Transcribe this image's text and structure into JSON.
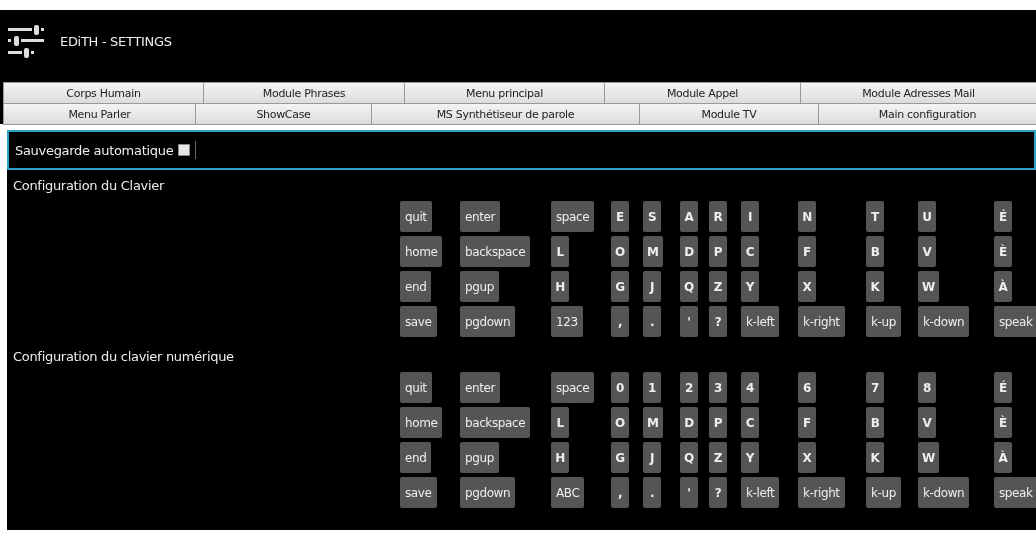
{
  "window": {
    "title": "EDiTH - SETTINGS"
  },
  "tab_rows": [
    {
      "tabs": [
        {
          "label": "Corps Humain",
          "selected": false
        },
        {
          "label": "Module Phrases",
          "selected": false
        },
        {
          "label": "Menu principal",
          "selected": false
        },
        {
          "label": "Module Appel",
          "selected": false
        },
        {
          "label": "Module Adresses Mail",
          "selected": false
        }
      ]
    },
    {
      "tabs": [
        {
          "label": "Menu Parler",
          "selected": false
        },
        {
          "label": "ShowCase",
          "selected": false
        },
        {
          "label": "MS Synthétiseur de parole",
          "selected": false
        },
        {
          "label": "Module TV",
          "selected": false
        },
        {
          "label": "Main configuration",
          "selected": false
        }
      ]
    }
  ],
  "autosave": {
    "label": "Sauvegarde automatique",
    "checked": false
  },
  "sections": [
    {
      "title": "Configuration du Clavier",
      "rows": [
        [
          {
            "label": "quit",
            "kind": "word"
          },
          {
            "label": "enter",
            "kind": "word"
          },
          {
            "label": "space",
            "kind": "word"
          },
          {
            "label": "E",
            "kind": "char"
          },
          {
            "label": "S",
            "kind": "char"
          },
          {
            "label": "A",
            "kind": "char"
          },
          {
            "label": "R",
            "kind": "char"
          },
          {
            "label": "I",
            "kind": "char"
          },
          {
            "label": "N",
            "kind": "char"
          },
          {
            "label": "T",
            "kind": "char"
          },
          {
            "label": "U",
            "kind": "char"
          },
          {
            "label": "É",
            "kind": "char"
          }
        ],
        [
          {
            "label": "home",
            "kind": "word"
          },
          {
            "label": "backspace",
            "kind": "word"
          },
          {
            "label": "L",
            "kind": "char"
          },
          {
            "label": "O",
            "kind": "char"
          },
          {
            "label": "M",
            "kind": "char"
          },
          {
            "label": "D",
            "kind": "char"
          },
          {
            "label": "P",
            "kind": "char"
          },
          {
            "label": "C",
            "kind": "char"
          },
          {
            "label": "F",
            "kind": "char"
          },
          {
            "label": "B",
            "kind": "char"
          },
          {
            "label": "V",
            "kind": "char"
          },
          {
            "label": "È",
            "kind": "char"
          }
        ],
        [
          {
            "label": "end",
            "kind": "word"
          },
          {
            "label": "pgup",
            "kind": "word"
          },
          {
            "label": "H",
            "kind": "char"
          },
          {
            "label": "G",
            "kind": "char"
          },
          {
            "label": "J",
            "kind": "char"
          },
          {
            "label": "Q",
            "kind": "char"
          },
          {
            "label": "Z",
            "kind": "char"
          },
          {
            "label": "Y",
            "kind": "char"
          },
          {
            "label": "X",
            "kind": "char"
          },
          {
            "label": "K",
            "kind": "char"
          },
          {
            "label": "W",
            "kind": "char"
          },
          {
            "label": "À",
            "kind": "char"
          }
        ],
        [
          {
            "label": "save",
            "kind": "word"
          },
          {
            "label": "pgdown",
            "kind": "word"
          },
          {
            "label": "123",
            "kind": "word"
          },
          {
            "label": ",",
            "kind": "char"
          },
          {
            "label": ".",
            "kind": "char"
          },
          {
            "label": "'",
            "kind": "char"
          },
          {
            "label": "?",
            "kind": "char"
          },
          {
            "label": "k-left",
            "kind": "word"
          },
          {
            "label": "k-right",
            "kind": "word"
          },
          {
            "label": "k-up",
            "kind": "word"
          },
          {
            "label": "k-down",
            "kind": "word"
          },
          {
            "label": "speak",
            "kind": "word"
          }
        ]
      ]
    },
    {
      "title": "Configuration du clavier numérique",
      "rows": [
        [
          {
            "label": "quit",
            "kind": "word"
          },
          {
            "label": "enter",
            "kind": "word"
          },
          {
            "label": "space",
            "kind": "word"
          },
          {
            "label": "0",
            "kind": "char"
          },
          {
            "label": "1",
            "kind": "char"
          },
          {
            "label": "2",
            "kind": "char"
          },
          {
            "label": "3",
            "kind": "char"
          },
          {
            "label": "4",
            "kind": "char"
          },
          {
            "label": "6",
            "kind": "char"
          },
          {
            "label": "7",
            "kind": "char"
          },
          {
            "label": "8",
            "kind": "char"
          },
          {
            "label": "É",
            "kind": "char"
          }
        ],
        [
          {
            "label": "home",
            "kind": "word"
          },
          {
            "label": "backspace",
            "kind": "word"
          },
          {
            "label": "L",
            "kind": "char"
          },
          {
            "label": "O",
            "kind": "char"
          },
          {
            "label": "M",
            "kind": "char"
          },
          {
            "label": "D",
            "kind": "char"
          },
          {
            "label": "P",
            "kind": "char"
          },
          {
            "label": "C",
            "kind": "char"
          },
          {
            "label": "F",
            "kind": "char"
          },
          {
            "label": "B",
            "kind": "char"
          },
          {
            "label": "V",
            "kind": "char"
          },
          {
            "label": "È",
            "kind": "char"
          }
        ],
        [
          {
            "label": "end",
            "kind": "word"
          },
          {
            "label": "pgup",
            "kind": "word"
          },
          {
            "label": "H",
            "kind": "char"
          },
          {
            "label": "G",
            "kind": "char"
          },
          {
            "label": "J",
            "kind": "char"
          },
          {
            "label": "Q",
            "kind": "char"
          },
          {
            "label": "Z",
            "kind": "char"
          },
          {
            "label": "Y",
            "kind": "char"
          },
          {
            "label": "X",
            "kind": "char"
          },
          {
            "label": "K",
            "kind": "char"
          },
          {
            "label": "W",
            "kind": "char"
          },
          {
            "label": "À",
            "kind": "char"
          }
        ],
        [
          {
            "label": "save",
            "kind": "word"
          },
          {
            "label": "pgdown",
            "kind": "word"
          },
          {
            "label": "ABC",
            "kind": "word"
          },
          {
            "label": ",",
            "kind": "char"
          },
          {
            "label": ".",
            "kind": "char"
          },
          {
            "label": "'",
            "kind": "char"
          },
          {
            "label": "?",
            "kind": "char"
          },
          {
            "label": "k-left",
            "kind": "word"
          },
          {
            "label": "k-right",
            "kind": "word"
          },
          {
            "label": "k-up",
            "kind": "word"
          },
          {
            "label": "k-down",
            "kind": "word"
          },
          {
            "label": "speak",
            "kind": "word"
          }
        ]
      ]
    }
  ]
}
